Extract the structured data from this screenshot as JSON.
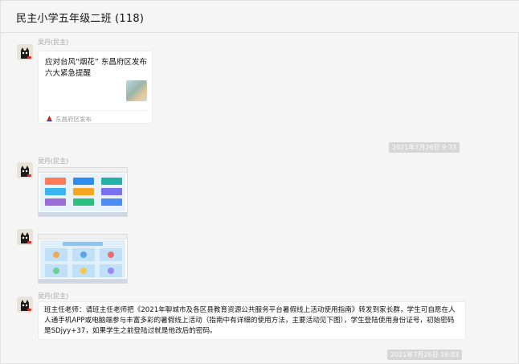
{
  "header": {
    "title": "民主小学五年级二班 (118)"
  },
  "messages": [
    {
      "sender": "吴丹(民主)",
      "card": {
        "title": "应对台风“烟花”  东昌府区发布六大紧急提醒",
        "source": "东昌府区发布"
      }
    },
    {
      "timestamp": "2021年7月26日 9:33"
    },
    {
      "sender": "吴丹(民主)",
      "image": "screenshot-menu-tiles-colored"
    },
    {
      "image": "screenshot-menu-tiles-blue"
    },
    {
      "sender": "吴丹(民主)",
      "text": "班主任老师：请班主任老师把《2021年聊城市及各区县教育资源公共服务平台暑假线上活动使用指南》转发到家长群，学生可自愿在人人通手机APP或电脑端参与丰富多彩的暑假线上活动（指南中有详细的使用方法，主要活动见下图），学生登陆使用身份证号，初始密码是SDjyy+37，如果学生之前登陆过就是他改后的密码。"
    },
    {
      "timestamp": "2021年7月26日 16:03"
    }
  ],
  "colors": {
    "background": "#f5f5f5",
    "bubble": "#ffffff",
    "timestamp_bg": "#d6d6d6",
    "avatar_bg": "#e9e2d8",
    "source_logo": "#c62828"
  }
}
